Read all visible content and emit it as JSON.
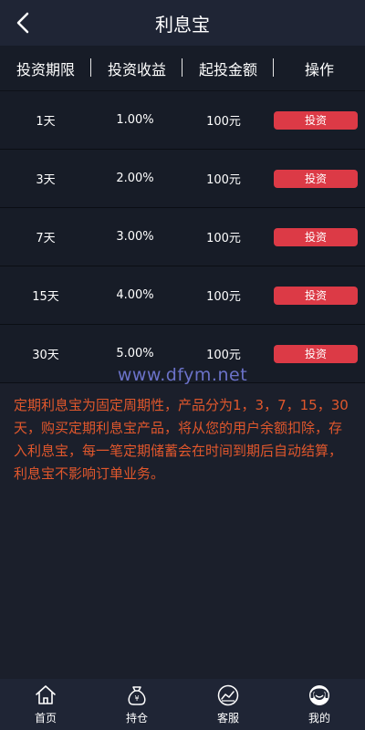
{
  "header": {
    "title": "利息宝"
  },
  "table": {
    "columns": [
      "投资期限",
      "投资收益",
      "起投金额",
      "操作"
    ],
    "rows": [
      {
        "term": "1天",
        "rate": "1.00%",
        "min_amount": "100元",
        "action": "投资"
      },
      {
        "term": "3天",
        "rate": "2.00%",
        "min_amount": "100元",
        "action": "投资"
      },
      {
        "term": "7天",
        "rate": "3.00%",
        "min_amount": "100元",
        "action": "投资"
      },
      {
        "term": "15天",
        "rate": "4.00%",
        "min_amount": "100元",
        "action": "投资"
      },
      {
        "term": "30天",
        "rate": "5.00%",
        "min_amount": "100元",
        "action": "投资"
      }
    ]
  },
  "watermark": "www.dfym.net",
  "description": "定期利息宝为固定周期性，产品分为1，3，7，15，30天，购买定期利息宝产品，将从您的用户余额扣除，存入利息宝，每一笔定期储蓄会在时间到期后自动结算，利息宝不影响订单业务。",
  "tabbar": {
    "items": [
      {
        "label": "首页",
        "icon": "home-icon"
      },
      {
        "label": "持仓",
        "icon": "money-bag-icon"
      },
      {
        "label": "客服",
        "icon": "chart-icon"
      },
      {
        "label": "我的",
        "icon": "profile-icon"
      }
    ]
  },
  "colors": {
    "background": "#1b1f2b",
    "invest_button": "#dc3a46",
    "description_text": "#e0572c",
    "watermark": "#6b72c9"
  }
}
